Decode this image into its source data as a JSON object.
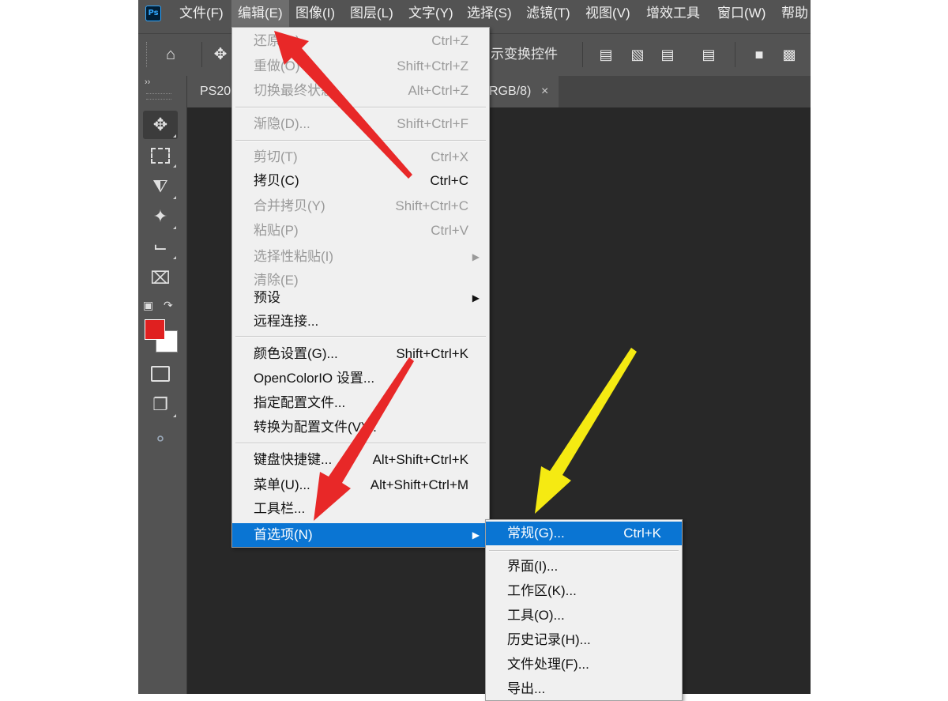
{
  "menubar": {
    "logo": "Ps",
    "items": [
      "文件(F)",
      "编辑(E)",
      "图像(I)",
      "图层(L)",
      "文字(Y)",
      "选择(S)",
      "滤镜(T)",
      "视图(V)",
      "增效工具",
      "窗口(W)",
      "帮助"
    ]
  },
  "options_bar": {
    "text": "示变换控件"
  },
  "document_tab": {
    "name": "PS20",
    "mode": "RGB/8)",
    "close": "×"
  },
  "toolbar": {
    "collapse": "››"
  },
  "colors": {
    "foreground": "#e02020",
    "background": "#ffffff",
    "highlight": "#0a75d3",
    "arrow_red": "#e82828",
    "arrow_yellow": "#f5ea12"
  },
  "edit_menu": {
    "items": [
      {
        "label": "还原(O)",
        "shortcut": "Ctrl+Z"
      },
      {
        "label": "重做(O)",
        "shortcut": "Shift+Ctrl+Z"
      },
      {
        "label": "切换最终状态",
        "shortcut": "Alt+Ctrl+Z"
      },
      {
        "label": "渐隐(D)...",
        "shortcut": "Shift+Ctrl+F"
      },
      {
        "label": "剪切(T)",
        "shortcut": "Ctrl+X"
      },
      {
        "label": "拷贝(C)",
        "shortcut": "Ctrl+C"
      },
      {
        "label": "合并拷贝(Y)",
        "shortcut": "Shift+Ctrl+C"
      },
      {
        "label": "粘贴(P)",
        "shortcut": "Ctrl+V"
      },
      {
        "label": "选择性粘贴(I)",
        "shortcut": ""
      },
      {
        "label": "清除(E)",
        "shortcut": ""
      },
      {
        "label": "预设",
        "shortcut": ""
      },
      {
        "label": "远程连接...",
        "shortcut": ""
      },
      {
        "label": "颜色设置(G)...",
        "shortcut": "Shift+Ctrl+K"
      },
      {
        "label": "OpenColorIO 设置...",
        "shortcut": ""
      },
      {
        "label": "指定配置文件...",
        "shortcut": ""
      },
      {
        "label": "转换为配置文件(V)...",
        "shortcut": ""
      },
      {
        "label": "键盘快捷键...",
        "shortcut": "Alt+Shift+Ctrl+K"
      },
      {
        "label": "菜单(U)...",
        "shortcut": "Alt+Shift+Ctrl+M"
      },
      {
        "label": "工具栏...",
        "shortcut": ""
      },
      {
        "label": "首选项(N)",
        "shortcut": ""
      }
    ]
  },
  "preferences_submenu": {
    "items": [
      {
        "label": "常规(G)...",
        "shortcut": "Ctrl+K"
      },
      {
        "label": "界面(I)...",
        "shortcut": ""
      },
      {
        "label": "工作区(K)...",
        "shortcut": ""
      },
      {
        "label": "工具(O)...",
        "shortcut": ""
      },
      {
        "label": "历史记录(H)...",
        "shortcut": ""
      },
      {
        "label": "文件处理(F)...",
        "shortcut": ""
      },
      {
        "label": "导出...",
        "shortcut": ""
      }
    ]
  }
}
